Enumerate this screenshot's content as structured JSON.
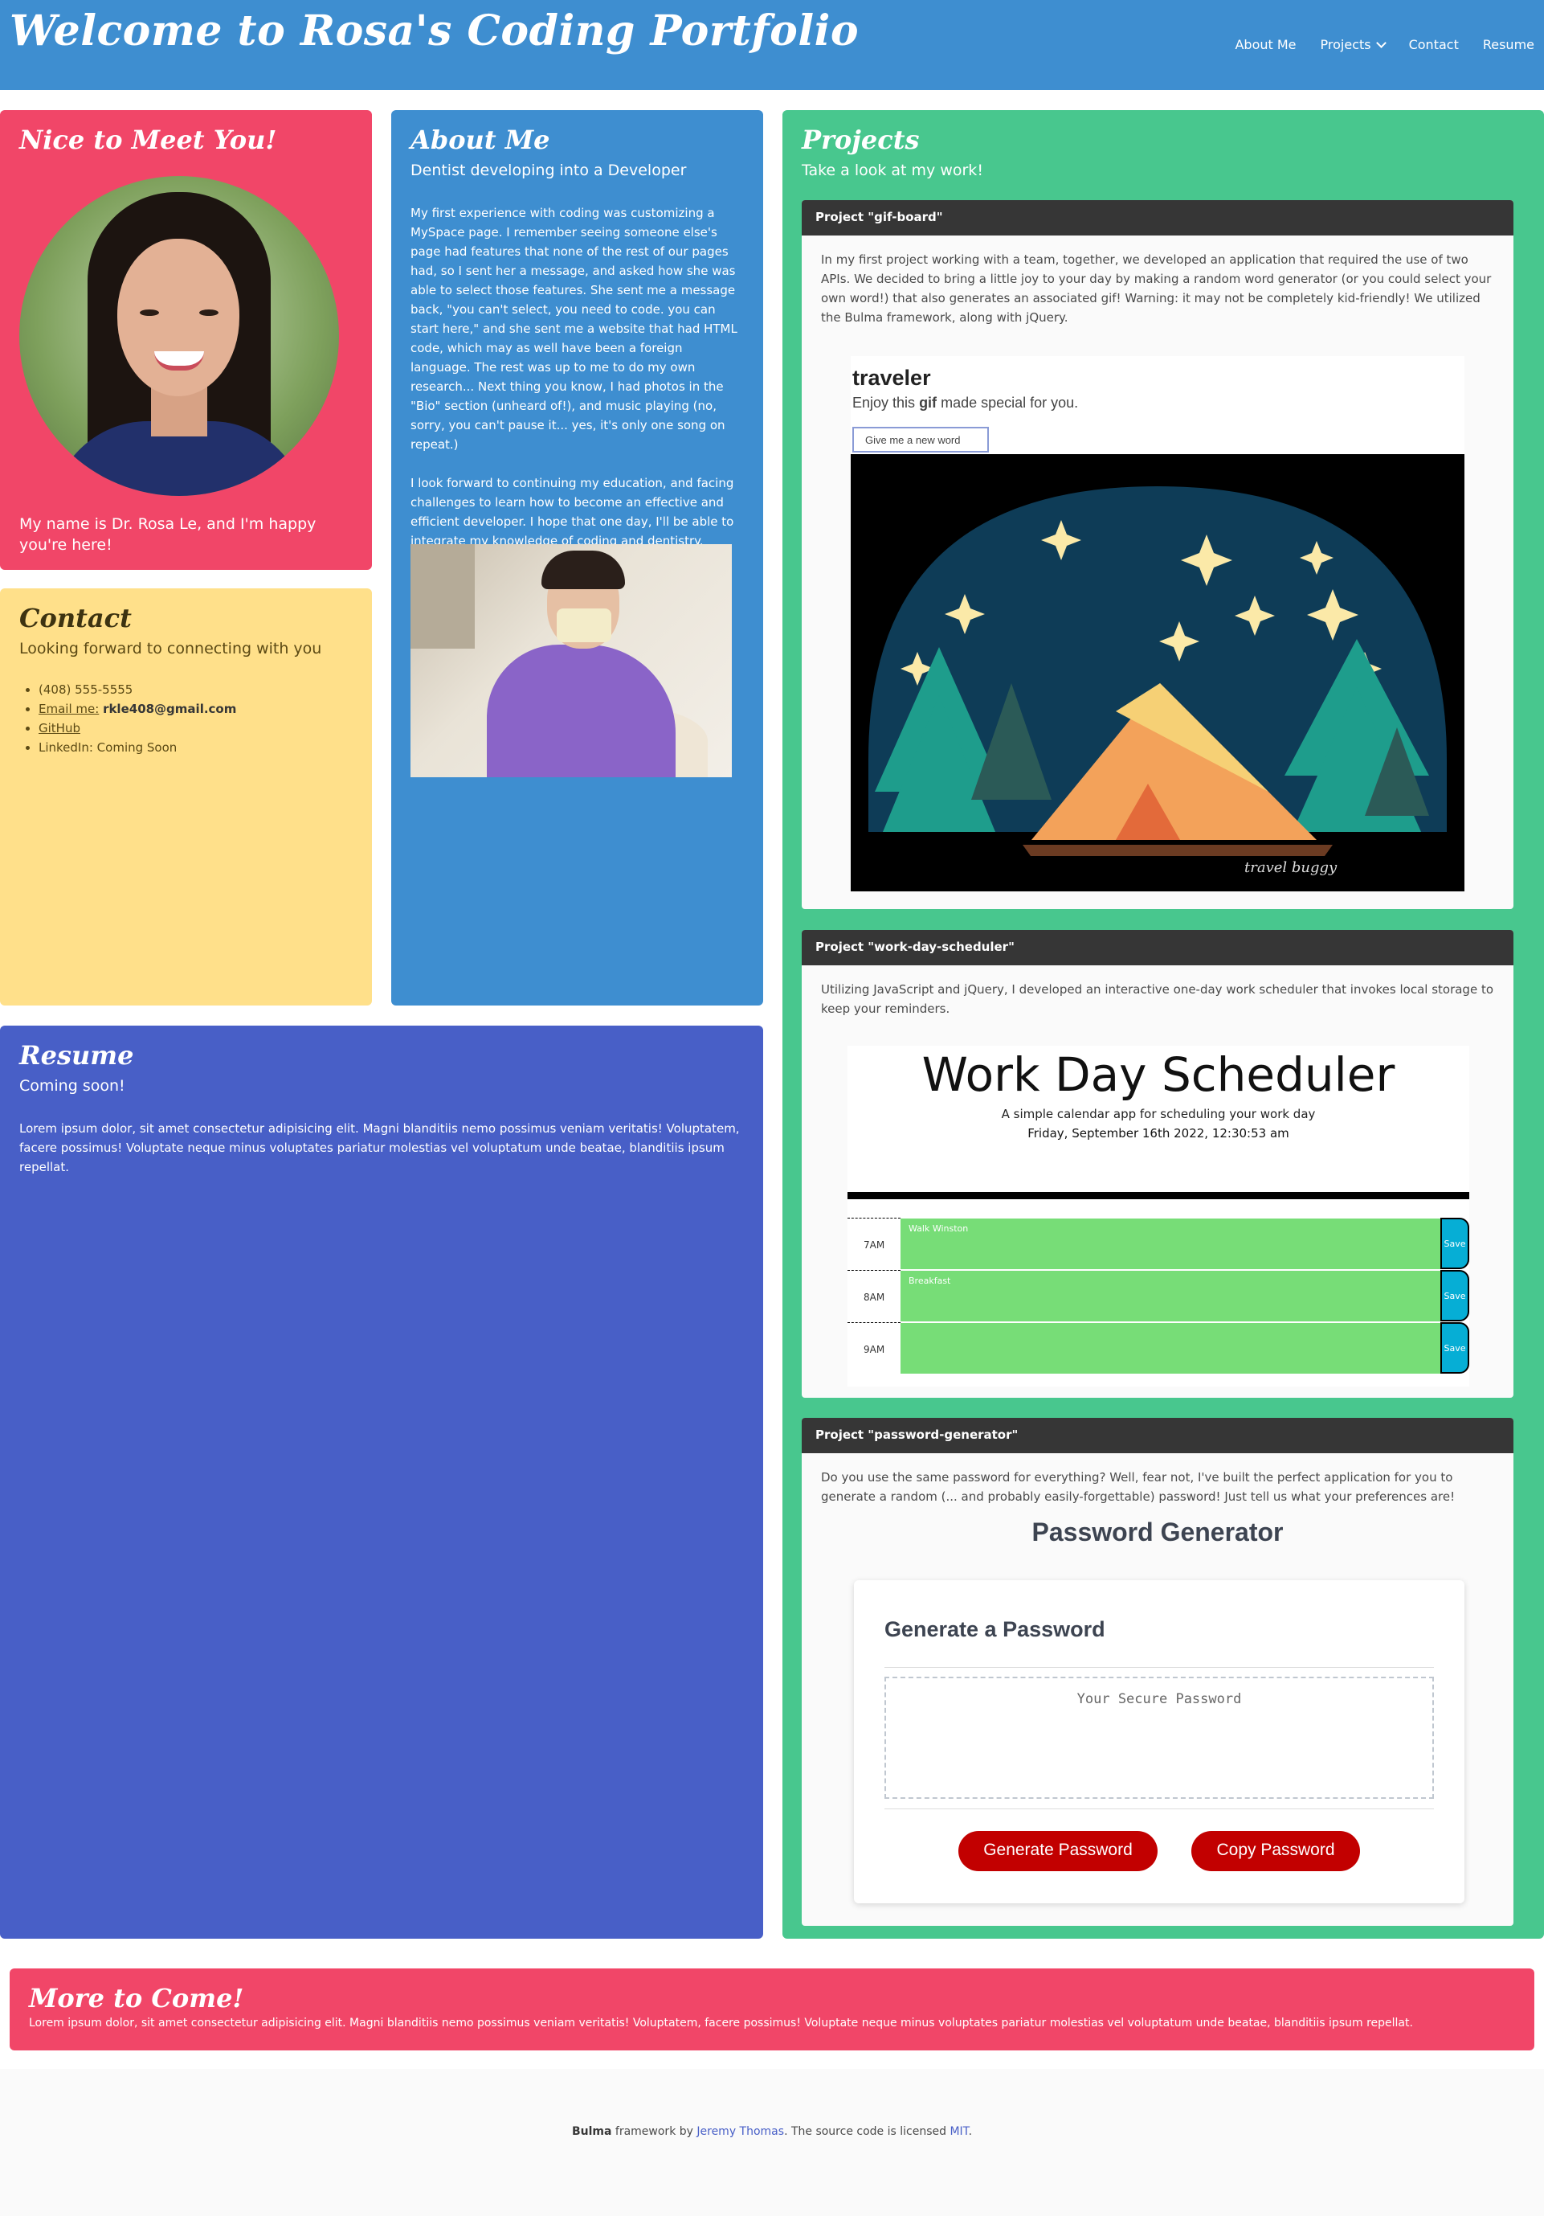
{
  "navbar": {
    "brand": "Welcome to Rosa's Coding Portfolio",
    "links": {
      "about": "About Me",
      "projects": "Projects",
      "contact": "Contact",
      "resume": "Resume"
    },
    "color": "#3e8ed0"
  },
  "meet": {
    "title": "Nice to Meet You!",
    "intro": "My name is Dr. Rosa Le, and I'm happy you're here!",
    "color": "#f14668"
  },
  "contact": {
    "title": "Contact",
    "subtitle": "Looking forward to connecting with you",
    "phone": "(408) 555-5555",
    "email_label": "Email me:",
    "email": "rkle408@gmail.com",
    "github": "GitHub",
    "linkedin": "LinkedIn: Coming Soon",
    "color": "#ffe08a"
  },
  "about": {
    "title": "About Me",
    "subtitle": "Dentist developing into a Developer",
    "para1": "My first experience with coding was customizing a MySpace page. I remember seeing someone else's page had features that none of the rest of our pages had, so I sent her a message, and asked how she was able to select those features. She sent me a message back, \"you can't select, you need to code. you can start here,\" and she sent me a website that had HTML code, which may as well have been a foreign language. The rest was up to me to do my own research... Next thing you know, I had photos in the \"Bio\" section (unheard of!), and music playing (no, sorry, you can't pause it... yes, it's only one song on repeat.)",
    "para2": "I look forward to continuing my education, and facing challenges to learn how to become an effective and efficient developer. I hope that one day, I'll be able to integrate my knowledge of coding and dentistry."
  },
  "resume": {
    "title": "Resume",
    "subtitle": "Coming soon!",
    "body": "Lorem ipsum dolor, sit amet consectetur adipisicing elit. Magni blanditiis nemo possimus veniam veritatis! Voluptatem, facere possimus! Voluptate neque minus voluptates pariatur molestias vel voluptatum unde beatae, blanditiis ipsum repellat.",
    "color": "#485fc7"
  },
  "projects": {
    "title": "Projects",
    "subtitle": "Take a look at my work!",
    "color": "#48c78e",
    "gif_board": {
      "header": "Project \"gif-board\"",
      "description": "In my first project working with a team, together, we developed an application that required the use of two APIs. We decided to bring a little joy to your day by making a random word generator (or you could select your own word!) that also generates an associated gif! Warning: it may not be completely kid-friendly! We utilized the Bulma framework, along with jQuery.",
      "shot_title": "traveler",
      "shot_sub_before": "Enjoy this",
      "shot_sub_bold": "gif",
      "shot_sub_after": "made special for you.",
      "shot_button": "Give me a new word",
      "gif_signature": "travel buggy"
    },
    "work_day": {
      "header": "Project \"work-day-scheduler\"",
      "description": "Utilizing JavaScript and jQuery, I developed an interactive one-day work scheduler that invokes local storage to keep your reminders.",
      "shot_title": "Work Day Scheduler",
      "shot_sub": "A simple calendar app for scheduling your work day",
      "shot_date": "Friday, September 16th 2022, 12:30:53 am",
      "rows": [
        {
          "hour": "7AM",
          "text": "Walk Winston",
          "save": "Save"
        },
        {
          "hour": "8AM",
          "text": "Breakfast",
          "save": "Save"
        },
        {
          "hour": "9AM",
          "text": "",
          "save": "Save"
        }
      ]
    },
    "password": {
      "header": "Project \"password-generator\"",
      "description": "Do you use the same password for everything? Well, fear not, I've built the perfect application for you to generate a random (... and probably easily-forgettable) password! Just tell us what your preferences are!",
      "shot_title": "Password Generator",
      "card_title": "Generate a Password",
      "placeholder": "Your Secure Password",
      "generate": "Generate Password",
      "copy": "Copy Password"
    }
  },
  "more": {
    "title": "More to Come!",
    "body": "Lorem ipsum dolor, sit amet consectetur adipisicing elit. Magni blanditiis nemo possimus veniam veritatis! Voluptatem, facere possimus! Voluptate neque minus voluptates pariatur molestias vel voluptatum unde beatae, blanditiis ipsum repellat."
  },
  "footer": {
    "bulma": "Bulma",
    "framework_by": "framework by",
    "author": "Jeremy Thomas",
    "licensed": ". The source code is licensed",
    "license": "MIT",
    "end": "."
  }
}
